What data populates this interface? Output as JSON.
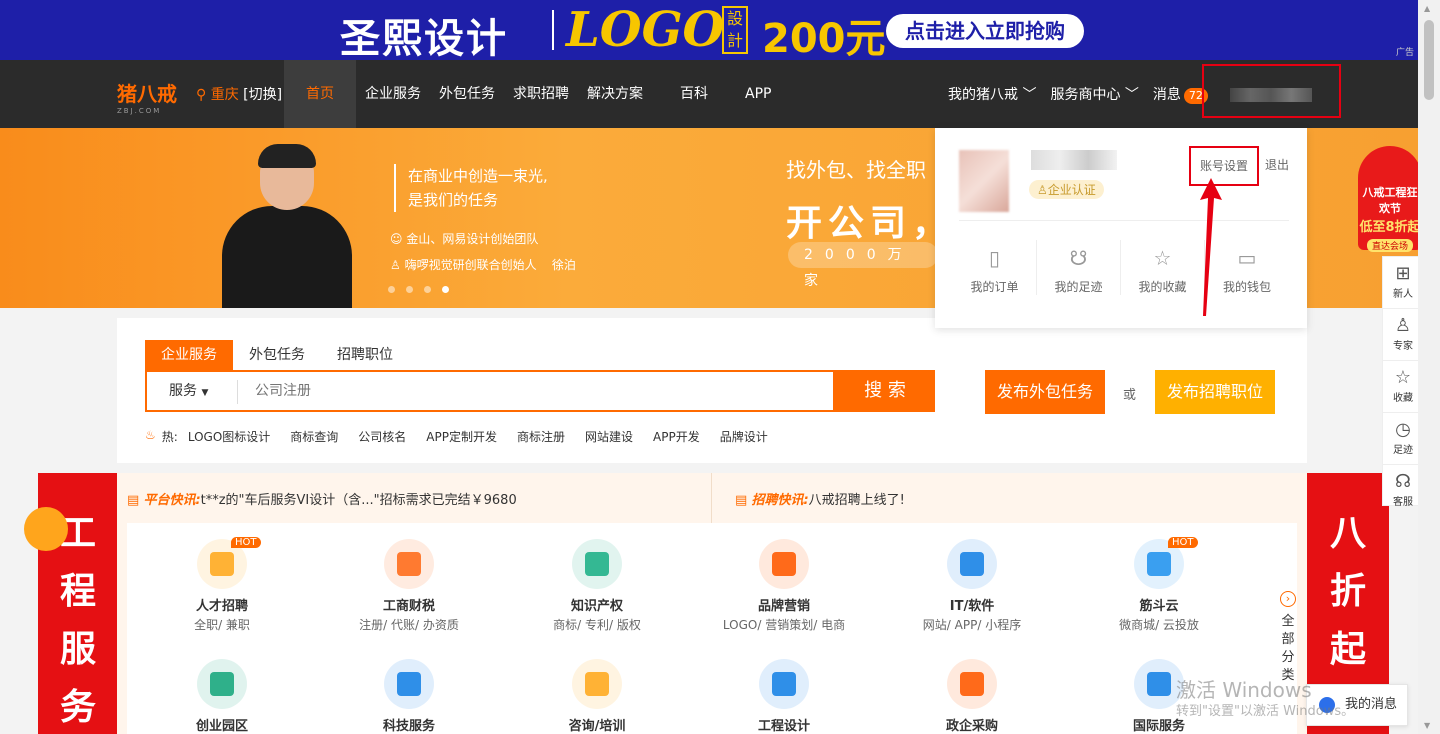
{
  "top_ad": {
    "brand": "圣熙设计",
    "logo_text": "LOGO",
    "seal_text": "設計",
    "price": "200元",
    "cta": "点击进入立即抢购",
    "ad_tag": "广告"
  },
  "nav": {
    "brand": "猪八戒",
    "brand_sub": "ZBJ.COM",
    "city": "重庆",
    "city_switch": "[切换]",
    "menu": [
      "首页",
      "企业服务",
      "外包任务",
      "求职招聘",
      "解决方案",
      "百科",
      "APP"
    ],
    "my_zbj": "我的猪八戒",
    "service_center": "服务商中心",
    "messages": "消息",
    "message_count": "72"
  },
  "banner": {
    "quote_line1": "在商业中创造一束光,",
    "quote_line2": "是我们的任务",
    "credit1": "金山、网易设计创始团队",
    "credit2_role": "嗨啰视觉研创联合创始人",
    "credit2_name": "徐泊",
    "slogan_top": "找外包、找全职",
    "slogan_main": "开公司，",
    "slogan_sub": "2000万家"
  },
  "account_dropdown": {
    "certification": "企业认证",
    "settings": "账号设置",
    "logout": "退出",
    "items": [
      {
        "label": "我的订单",
        "icon": "order-icon"
      },
      {
        "label": "我的足迹",
        "icon": "footprint-icon"
      },
      {
        "label": "我的收藏",
        "icon": "star-icon"
      },
      {
        "label": "我的钱包",
        "icon": "wallet-icon"
      }
    ]
  },
  "search": {
    "tabs": [
      "企业服务",
      "外包任务",
      "招聘职位"
    ],
    "type": "服务",
    "placeholder": "公司注册",
    "button": "搜 索",
    "publish_task": "发布外包任务",
    "or": "或",
    "publish_job": "发布招聘职位",
    "hot_label": "热:",
    "hot": [
      "LOGO图标设计",
      "商标查询",
      "公司核名",
      "APP定制开发",
      "商标注册",
      "网站建设",
      "APP开发",
      "品牌设计"
    ]
  },
  "news": {
    "platform_label": "平台快讯:",
    "platform_text": "t**z的\"车后服务VI设计（含...\"招标需求已完结￥9680",
    "recruit_label": "招聘快讯:",
    "recruit_text": "八戒招聘上线了!"
  },
  "categories": [
    {
      "name": "人才招聘",
      "sub": "全职/ 兼职",
      "hot": "HOT",
      "color": "#ffb235"
    },
    {
      "name": "工商财税",
      "sub": "注册/ 代账/ 办资质",
      "hot": "",
      "color": "#ff7a30"
    },
    {
      "name": "知识产权",
      "sub": "商标/ 专利/ 版权",
      "hot": "",
      "color": "#34b893"
    },
    {
      "name": "品牌营销",
      "sub": "LOGO/ 营销策划/ 电商",
      "hot": "",
      "color": "#ff6a1a"
    },
    {
      "name": "IT/软件",
      "sub": "网站/ APP/ 小程序",
      "hot": "",
      "color": "#2f8fe8"
    },
    {
      "name": "筋斗云",
      "sub": "微商城/ 云投放",
      "hot": "HOT",
      "color": "#3a9ff0"
    },
    {
      "name": "创业园区",
      "sub": "",
      "hot": "",
      "color": "#2fb08a"
    },
    {
      "name": "科技服务",
      "sub": "",
      "hot": "",
      "color": "#2f8fe8"
    },
    {
      "name": "咨询/培训",
      "sub": "",
      "hot": "",
      "color": "#ffb235"
    },
    {
      "name": "工程设计",
      "sub": "",
      "hot": "",
      "color": "#2f8fe8"
    },
    {
      "name": "政企采购",
      "sub": "",
      "hot": "",
      "color": "#ff6a1a"
    },
    {
      "name": "国际服务",
      "sub": "",
      "hot": "",
      "color": "#2f8fe8"
    }
  ],
  "all_categories": "全部分类",
  "left_banner": "工程服务",
  "right_banner": "八折起",
  "promo": {
    "line1": "八戒工程狂欢节",
    "line2": "低至8折起",
    "cta": "直达会场"
  },
  "sidebar": [
    {
      "label": "新人",
      "icon": "gift-icon"
    },
    {
      "label": "专家",
      "icon": "user-icon"
    },
    {
      "label": "收藏",
      "icon": "star-icon"
    },
    {
      "label": "足迹",
      "icon": "clock-icon"
    },
    {
      "label": "客服",
      "icon": "headset-icon"
    }
  ],
  "my_messages": "我的消息",
  "watermark": {
    "line1": "激活 Windows",
    "line2": "转到\"设置\"以激活 Windows。"
  },
  "colors": {
    "accent": "#ff6a00",
    "nav_bg": "#2b2b2b",
    "ad_bg": "#1e1fa8",
    "red": "#e51013"
  }
}
